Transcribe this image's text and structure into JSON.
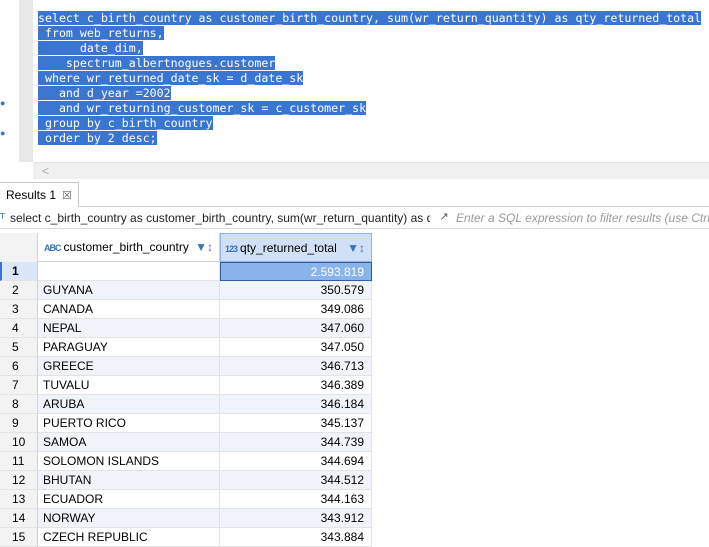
{
  "editor": {
    "lines": [
      "select c_birth_country as customer_birth_country, sum(wr_return_quantity) as qty_returned_total",
      " from web_returns,",
      "      date_dim,",
      "    spectrum_albertnogues.customer",
      " where wr_returned_date_sk = d_date_sk",
      "   and d_year =2002",
      "   and wr_returning_customer_sk = c_customer_sk",
      " group by c_birth_country",
      " order by 2 desc;"
    ]
  },
  "results_tab": {
    "label": "Results 1",
    "close_glyph": "☒"
  },
  "filter": {
    "query_text": "select c_birth_country as customer_birth_country, sum(wr_return_quantity) as q",
    "placeholder": "Enter a SQL expression to filter results (use Ctrl+Space)"
  },
  "grid": {
    "columns": [
      {
        "type_badge": "ABC",
        "label": "customer_birth_country"
      },
      {
        "type_badge": "123",
        "label": "qty_returned_total"
      }
    ],
    "rows": [
      {
        "num": "1",
        "country": "",
        "qty": "2.593.819"
      },
      {
        "num": "2",
        "country": "GUYANA",
        "qty": "350.579"
      },
      {
        "num": "3",
        "country": "CANADA",
        "qty": "349.086"
      },
      {
        "num": "4",
        "country": "NEPAL",
        "qty": "347.060"
      },
      {
        "num": "5",
        "country": "PARAGUAY",
        "qty": "347.050"
      },
      {
        "num": "6",
        "country": "GREECE",
        "qty": "346.713"
      },
      {
        "num": "7",
        "country": "TUVALU",
        "qty": "346.389"
      },
      {
        "num": "8",
        "country": "ARUBA",
        "qty": "346.184"
      },
      {
        "num": "9",
        "country": "PUERTO RICO",
        "qty": "345.137"
      },
      {
        "num": "10",
        "country": "SAMOA",
        "qty": "344.739"
      },
      {
        "num": "11",
        "country": "SOLOMON ISLANDS",
        "qty": "344.694"
      },
      {
        "num": "12",
        "country": "BHUTAN",
        "qty": "344.512"
      },
      {
        "num": "13",
        "country": "ECUADOR",
        "qty": "344.163"
      },
      {
        "num": "14",
        "country": "NORWAY",
        "qty": "343.912"
      },
      {
        "num": "15",
        "country": "CZECH REPUBLIC",
        "qty": "343.884"
      }
    ]
  },
  "colors": {
    "selection": "#3a76d1",
    "accent": "#3b73b9"
  }
}
